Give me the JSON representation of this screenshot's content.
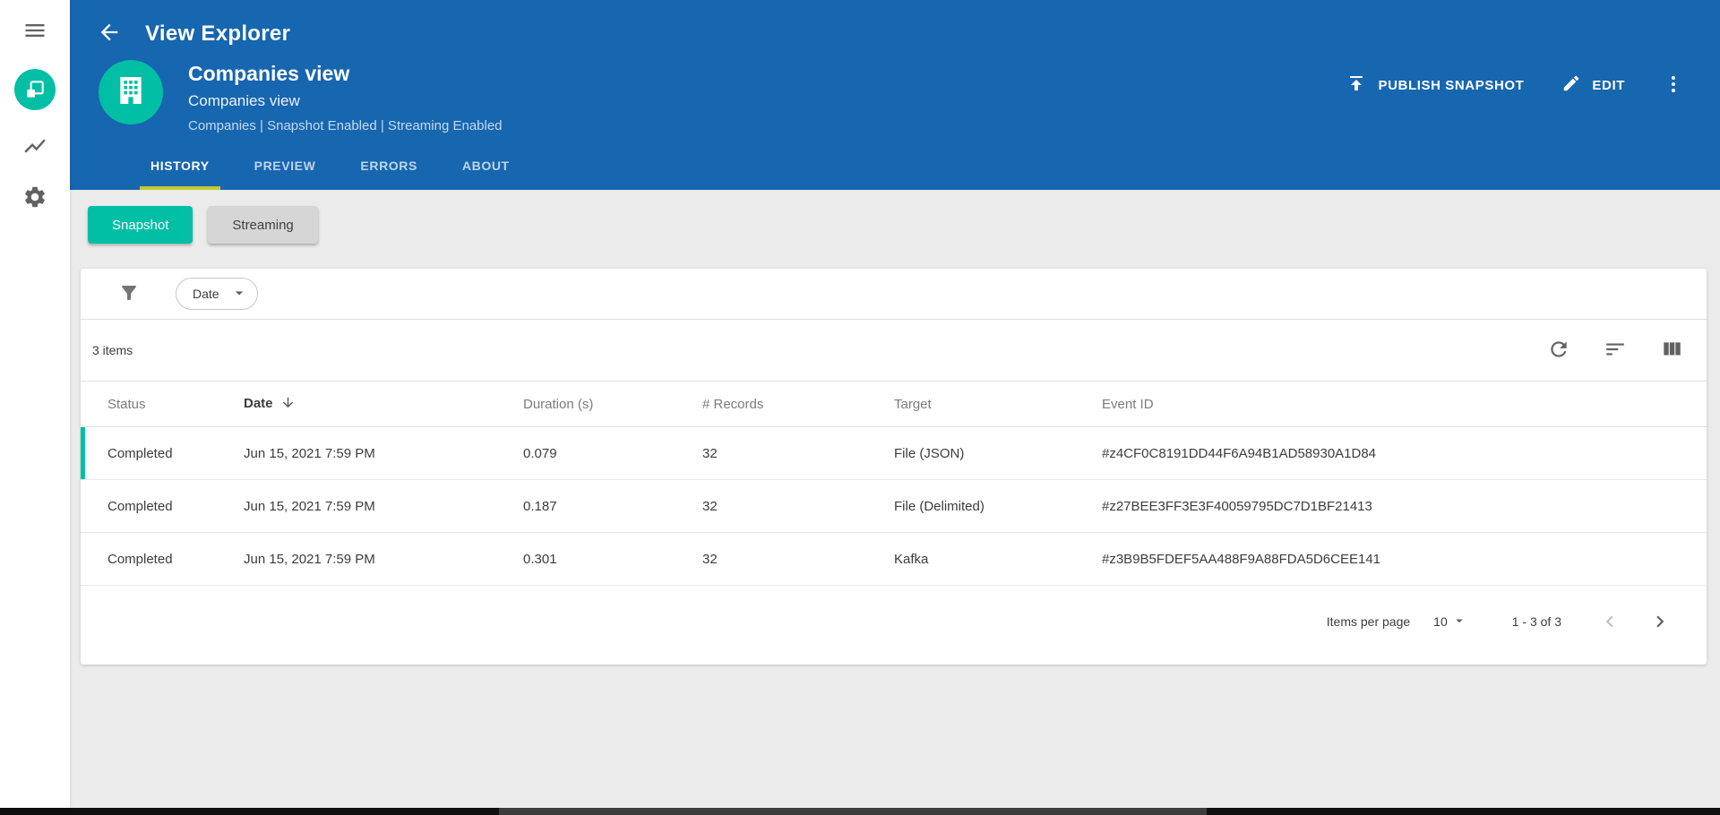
{
  "header": {
    "app_title": "View Explorer",
    "view_title": "Companies view",
    "view_subtitle": "Companies view",
    "view_meta": "Companies | Snapshot Enabled | Streaming Enabled",
    "actions": {
      "publish": "PUBLISH SNAPSHOT",
      "edit": "EDIT"
    },
    "tabs": [
      {
        "label": "HISTORY",
        "active": true
      },
      {
        "label": "PREVIEW",
        "active": false
      },
      {
        "label": "ERRORS",
        "active": false
      },
      {
        "label": "ABOUT",
        "active": false
      }
    ]
  },
  "toggles": {
    "snapshot": "Snapshot",
    "streaming": "Streaming"
  },
  "filter": {
    "date_label": "Date"
  },
  "table": {
    "items_count": "3 items",
    "columns": [
      "Status",
      "Date",
      "Duration (s)",
      "# Records",
      "Target",
      "Event ID"
    ],
    "rows": [
      {
        "status": "Completed",
        "date": "Jun 15, 2021 7:59 PM",
        "duration": "0.079",
        "records": "32",
        "target": "File (JSON)",
        "event_id": "#z4CF0C8191DD44F6A94B1AD58930A1D84"
      },
      {
        "status": "Completed",
        "date": "Jun 15, 2021 7:59 PM",
        "duration": "0.187",
        "records": "32",
        "target": "File (Delimited)",
        "event_id": "#z27BEE3FF3E3F40059795DC7D1BF21413"
      },
      {
        "status": "Completed",
        "date": "Jun 15, 2021 7:59 PM",
        "duration": "0.301",
        "records": "32",
        "target": "Kafka",
        "event_id": "#z3B9B5FDEF5AA488F9A88FDA5D6CEE141"
      }
    ]
  },
  "pagination": {
    "items_per_page_label": "Items per page",
    "page_size": "10",
    "range": "1 - 3 of 3"
  },
  "icons": [
    "menu-icon",
    "views-icon",
    "chart-icon",
    "settings-gear-icon",
    "back-arrow-icon",
    "building-icon",
    "publish-icon",
    "edit-pencil-icon",
    "kebab-menu-icon",
    "filter-funnel-icon",
    "chevron-down-icon",
    "refresh-icon",
    "sort-icon",
    "columns-icon",
    "sort-desc-arrow-icon",
    "chevron-left-icon",
    "chevron-right-icon",
    "scrollbar-thumb"
  ],
  "colors": {
    "app_bar": "#1766B0",
    "accent": "#00BFA5",
    "tab_underline": "#C0CA33",
    "page_bg": "#EBEBEB",
    "selected_row_border": "#00BFA5"
  }
}
